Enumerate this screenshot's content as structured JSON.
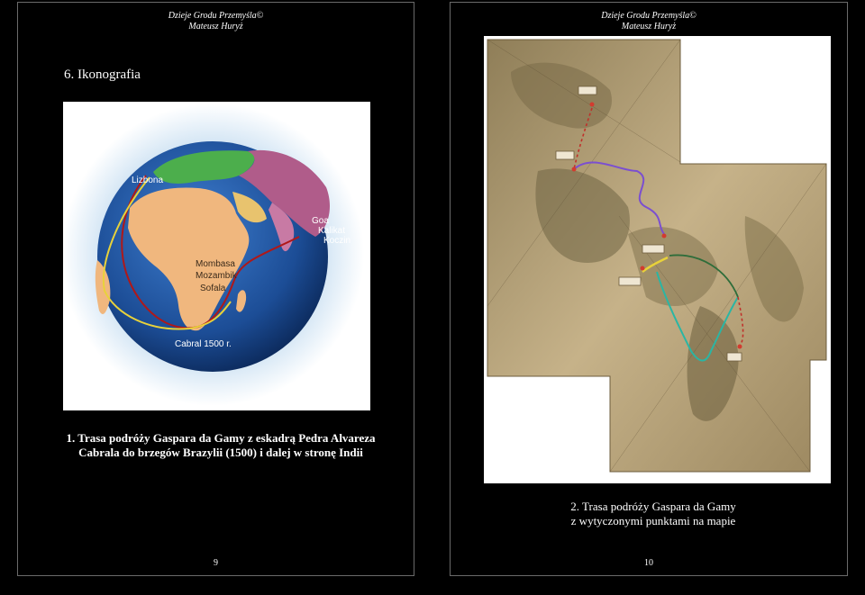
{
  "left_page": {
    "header_line1": "Dzieje Grodu Przemyśla©",
    "header_line2": "Mateusz Huryż",
    "section_title": "6. Ikonografia",
    "figure": {
      "labels": {
        "lisbon": "Lizbona",
        "goa": "Goa",
        "calicut": "Kalikat",
        "cochin": "Koczin",
        "mombasa": "Mombasa",
        "mozambique": "Mozambik",
        "sofala": "Sofala",
        "cabral": "Cabral 1500 r."
      }
    },
    "caption_line1": "1. Trasa podróży Gaspara da Gamy z eskadrą Pedra Alvareza",
    "caption_line2": "Cabrala do brzegów Brazylii (1500) i dalej w stronę Indii",
    "page_number": "9"
  },
  "right_page": {
    "header_line1": "Dzieje Grodu Przemyśla©",
    "header_line2": "Mateusz Huryż",
    "caption_line1": "2. Trasa podróży Gaspara da Gamy",
    "caption_line2": "z wytyczonymi punktami na mapie",
    "page_number": "10"
  },
  "colors": {
    "page_bg": "#000000",
    "page_border": "#6a6a6a",
    "ocean": "#1c4d96",
    "africa": "#f0b77e",
    "europe": "#4cae4c",
    "asia": "#b05c8a",
    "route_gama": "#b01818",
    "route_cabral": "#e8d23a",
    "parchment": "#b9a47a"
  }
}
